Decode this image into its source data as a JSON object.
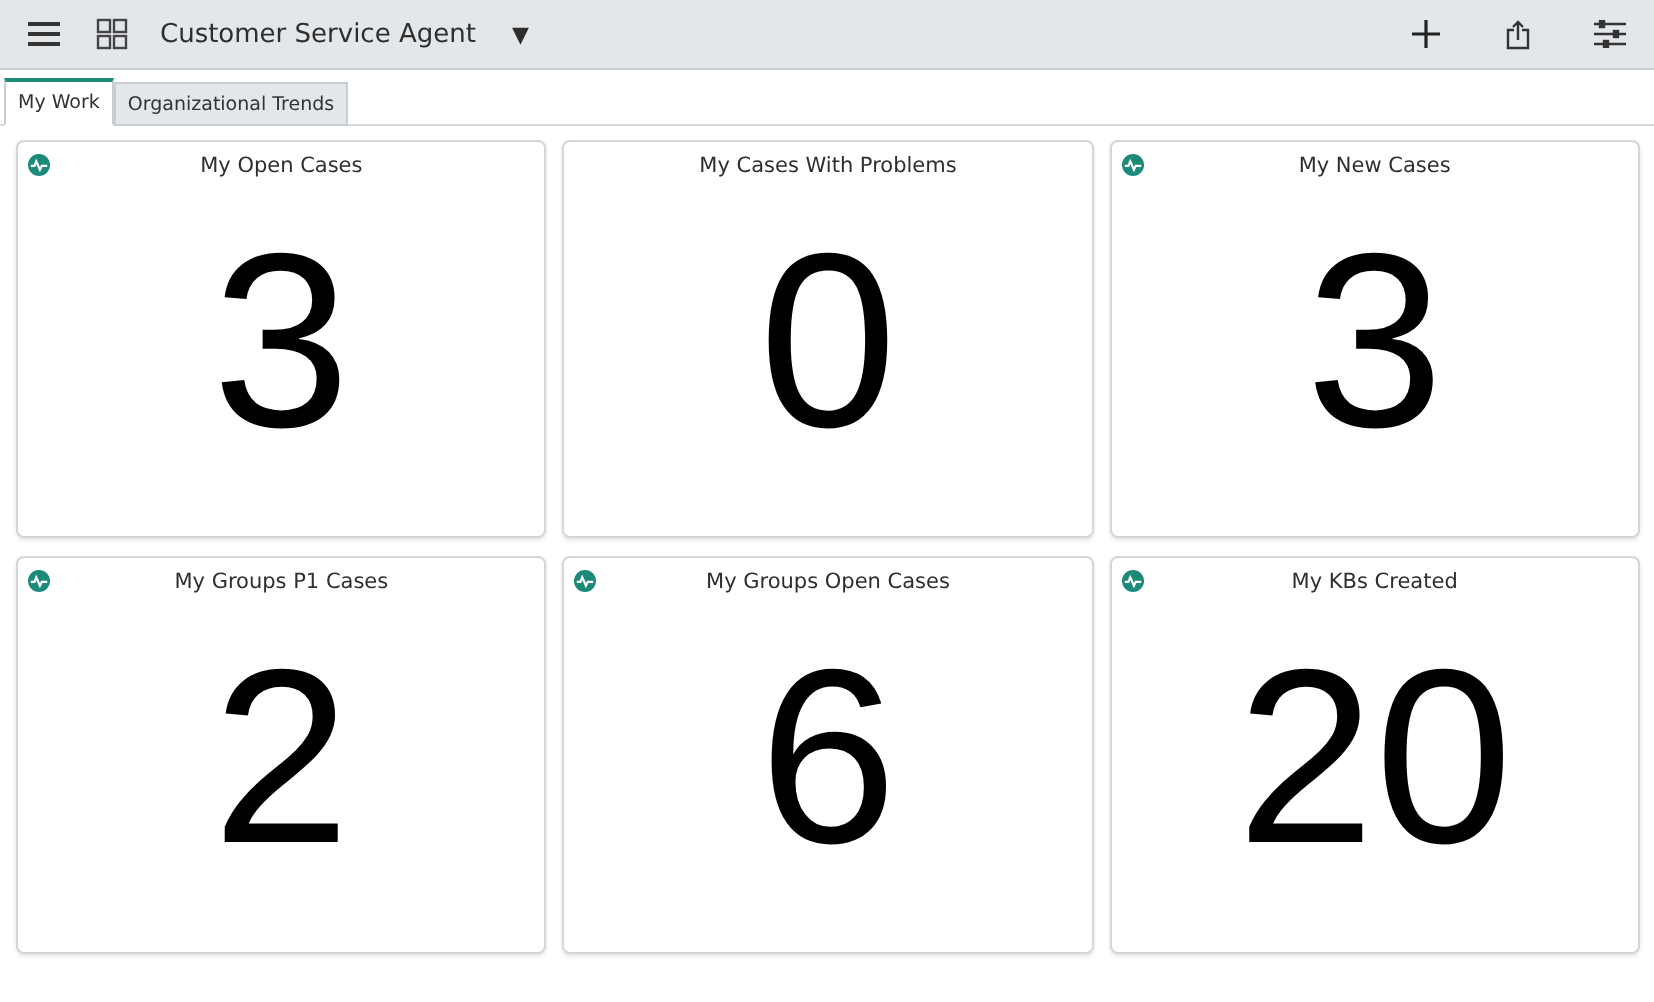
{
  "header": {
    "title": "Customer Service Agent",
    "dropdown": "▼"
  },
  "tabs": [
    {
      "label": "My Work",
      "selected": true
    },
    {
      "label": "Organizational Trends",
      "selected": false
    }
  ],
  "cards": [
    {
      "title": "My Open Cases",
      "value": "3",
      "has_icon": true
    },
    {
      "title": "My Cases With Problems",
      "value": "0",
      "has_icon": false
    },
    {
      "title": "My New Cases",
      "value": "3",
      "has_icon": true
    },
    {
      "title": "My Groups P1 Cases",
      "value": "2",
      "has_icon": true
    },
    {
      "title": "My Groups Open Cases",
      "value": "6",
      "has_icon": true
    },
    {
      "title": "My KBs Created",
      "value": "20",
      "has_icon": true
    }
  ]
}
